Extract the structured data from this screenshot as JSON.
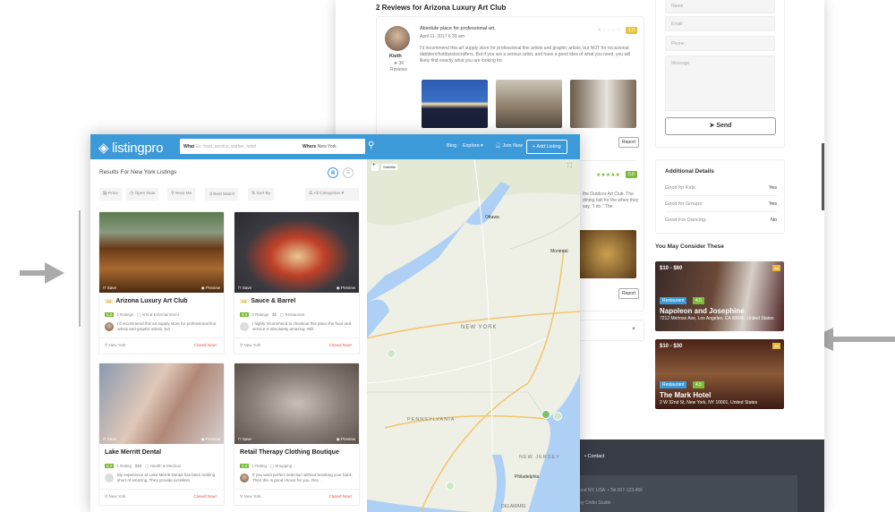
{
  "detail_page": {
    "reviews_title": "2 Reviews for Arizona Luxury Art Club",
    "reviews": [
      {
        "title": "Absolute place for professional art.",
        "date": "April 11, 2017 6:39 am",
        "author": "Kieth",
        "author_reviews": "36",
        "author_reviews_label": "Reviews",
        "rating": "1.0",
        "text": "I'd recommend this art supply store for professional fine artists and graphic artists, but NOT for occasional dabblers/hobbyists/crafters. But if you are a serious artist, and have a good idea of what you need, you will likely find exactly what you are looking for.",
        "report_label": "Report"
      },
      {
        "rating": "5.0",
        "text_fragment": "the Outdoor Art Club. The dining hall for the when they say, \"I do.\" The",
        "report_label": "Report"
      }
    ],
    "contact_form": {
      "name_placeholder": "Name",
      "email_placeholder": "Email",
      "phone_placeholder": "Phone",
      "message_placeholder": "Message",
      "send_label": "Send"
    },
    "additional_details": {
      "title": "Additional Details",
      "rows": [
        {
          "label": "Good for Kids:",
          "value": "Yes"
        },
        {
          "label": "Good for Groups:",
          "value": "Yes"
        },
        {
          "label": "Good For Dancing:",
          "value": "No"
        }
      ]
    },
    "consider": {
      "title": "You May Consider These",
      "items": [
        {
          "price": "$10 - $60",
          "ad": "Ad",
          "category": "Restaurant",
          "rating": "4.5",
          "name": "Napoleon and Josephine",
          "address": "7212 Melrose Ave, Los Angeles, CA 90046, United States"
        },
        {
          "price": "$10 - $30",
          "ad": "Ad",
          "category": "Restaurant",
          "rating": "4.5",
          "name": "The Mark Hotel",
          "address": "2 W 32nd St, New York, NY 10001, United States"
        }
      ]
    },
    "footer": {
      "link": "Contact",
      "address": "...ood NY, USA",
      "phone": "Tel 007-123-456",
      "credit": "...by Cridio Studio"
    }
  },
  "app": {
    "logo": "listingpro",
    "search": {
      "what_label": "What",
      "what_placeholder": "Ex: food, service, barber, hotel",
      "where_label": "Where",
      "where_value": "New York"
    },
    "nav": {
      "blog": "Blog",
      "explore": "Explore",
      "join": "Join Now",
      "add_listing": "+ Add Listing"
    },
    "results_title": "Results For New York Listings",
    "filters": [
      "Price",
      "Open Now",
      "Near Me",
      "Best Match",
      "Sort By"
    ],
    "categories_select": "All Categories",
    "map": {
      "satellite": "Satellite",
      "zoom_in": "+",
      "labels": [
        "NEW YORK",
        "PENNSYLVANIA",
        "NEW JERSEY",
        "Philadelphia",
        "DELAWARE",
        "Ottawa",
        "Montreal"
      ]
    },
    "listings": [
      {
        "ad": "Ad",
        "name": "Arizona Luxury Art Club",
        "rating": "5.0",
        "ratings_count": "2 Ratings",
        "price": "",
        "category": "Arts & Entertainment",
        "snippet": "I'd recommend this art supply store for professional fine artists and graphic artists, but",
        "location": "New York",
        "status": "Closed Now!",
        "save": "Save",
        "preview": "Preview"
      },
      {
        "ad": "Ad",
        "name": "Sauce & Barrel",
        "rating": "5.0",
        "ratings_count": "2 Ratings",
        "price": "$$",
        "category": "Restaurant",
        "snippet": "I highly recommend to checkout this place the food and service is absolutely amazing. Will",
        "location": "New York",
        "status": "Closed Now!",
        "save": "Save",
        "preview": "Preview"
      },
      {
        "ad": "",
        "name": "Lake Merritt Dental",
        "rating": "5.0",
        "ratings_count": "1 Rating",
        "price": "$$$",
        "category": "Health & Medical",
        "snippet": "My experience at Lake Merritt Dental has been nothing short of amazing. They provide excellent",
        "location": "New York",
        "status": "Closed Now!",
        "save": "Save",
        "preview": "Preview"
      },
      {
        "ad": "",
        "name": "Retail Therapy Clothing Boutique",
        "rating": "5.0",
        "ratings_count": "1 Rating",
        "price": "",
        "category": "Shopping",
        "snippet": "If you want perfect selection without breaking your bank. Then this is good choice for you. Ret...",
        "location": "New York",
        "status": "Closed Now!",
        "save": "Save",
        "preview": "Preview"
      }
    ]
  },
  "colors": {
    "brand_blue": "#3d9ad8",
    "rating_green": "#7cbb3a",
    "closed_red": "#e4504a",
    "footer_dark": "#373c45"
  }
}
